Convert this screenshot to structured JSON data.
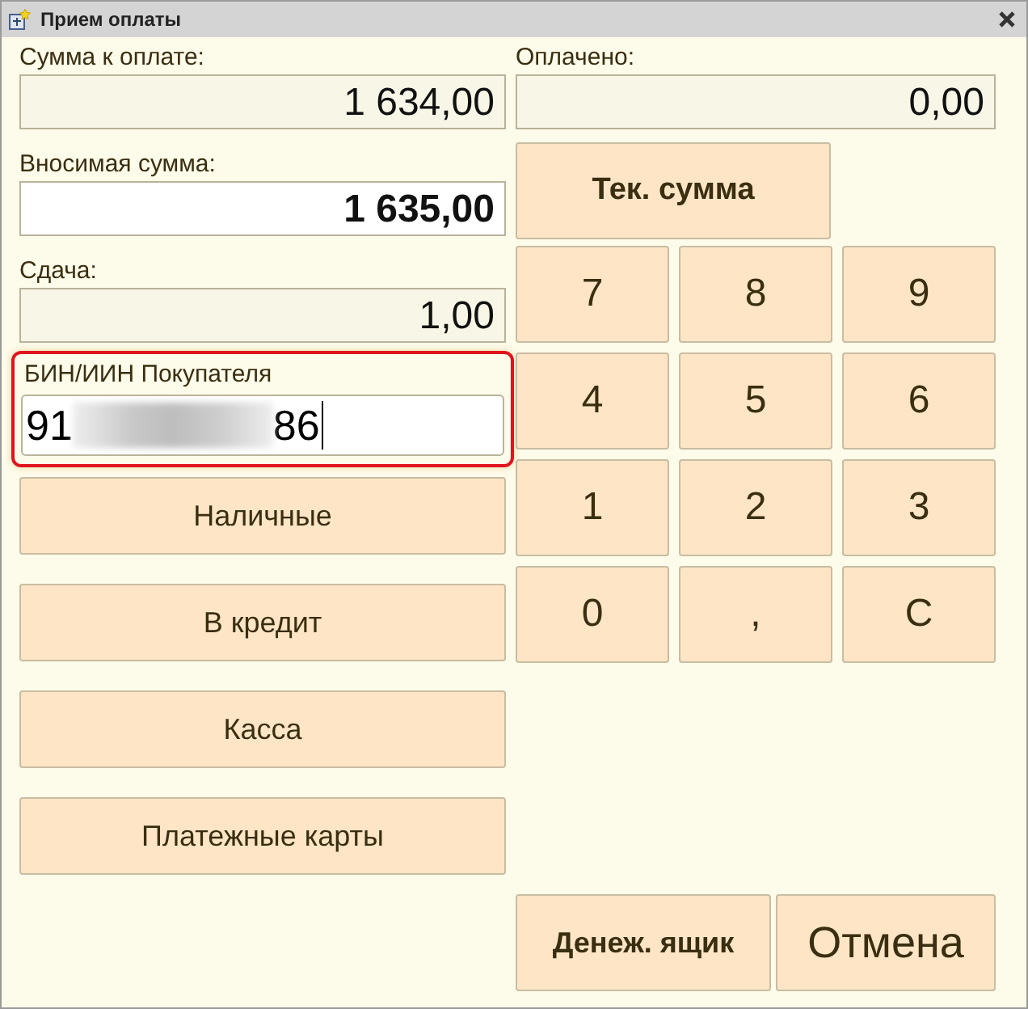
{
  "window": {
    "title": "Прием оплаты"
  },
  "fields": [
    {
      "label": "Сумма к оплате:",
      "value": "1 634,00",
      "kind": "readonly"
    },
    {
      "label": "Вносимая сумма:",
      "value": "1 635,00",
      "kind": "input"
    },
    {
      "label": "Сдача:",
      "value": "1,00",
      "kind": "readonly"
    }
  ],
  "customer_id": {
    "label": "БИН/ИИН Покупателя",
    "value_start": "91",
    "value_end": "86",
    "focused": true
  },
  "payment_buttons": [
    "Наличные",
    "В кредит",
    "Касса",
    "Платежные карты"
  ],
  "paid": {
    "label": "Оплачено:",
    "value": "0,00"
  },
  "current_sum_button": "Тек. сумма",
  "keypad": [
    "7",
    "8",
    "9",
    "4",
    "5",
    "6",
    "1",
    "2",
    "3",
    "0",
    ",",
    "C"
  ],
  "bottom_buttons": [
    {
      "label": "Денеж. ящик",
      "kind": "bold"
    },
    {
      "label": "Отмена",
      "kind": "large"
    }
  ]
}
